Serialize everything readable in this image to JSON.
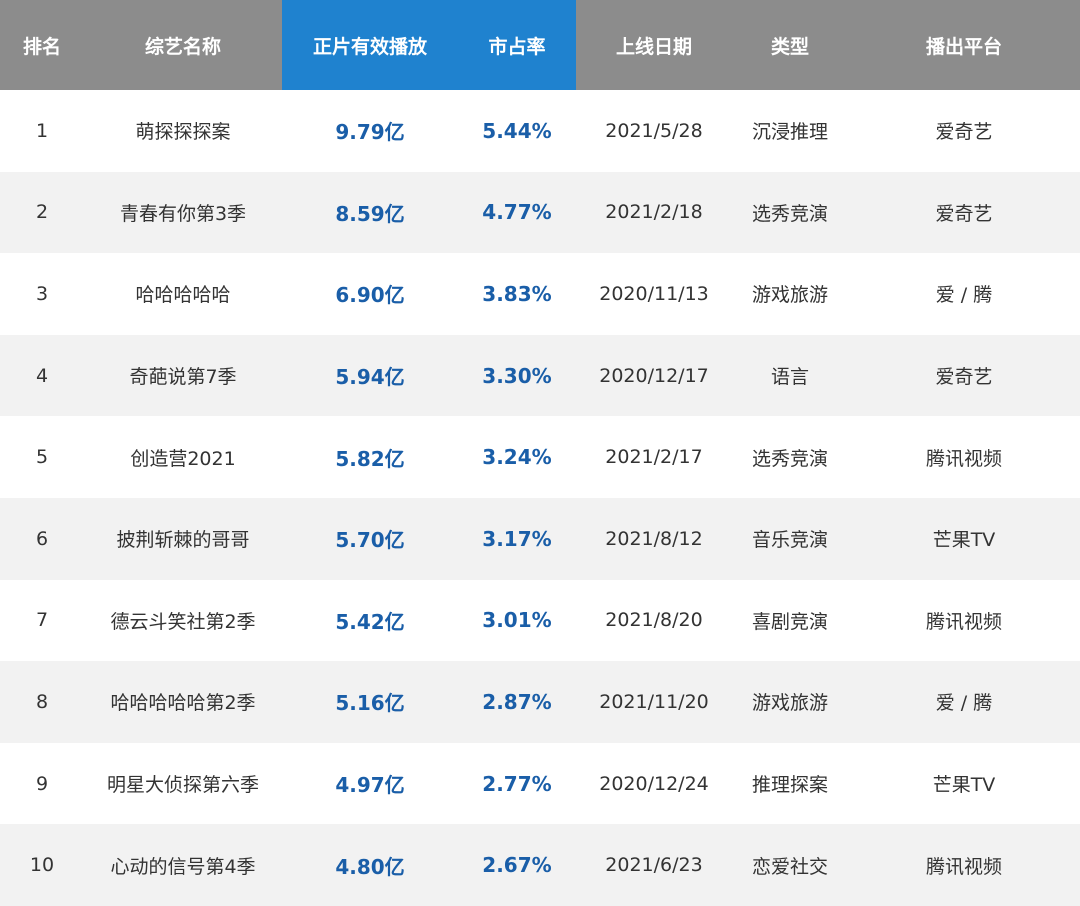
{
  "header": [
    "排名",
    "综艺名称",
    "正片有效播放",
    "市占率",
    "上线日期",
    "类型",
    "播出平台"
  ],
  "highlight_color": "#1f82cf",
  "header_color": "#8c8c8c",
  "value_color": "#1a5ea8",
  "rows": [
    [
      "1",
      "萌探探探案",
      "9.79亿",
      "5.44%",
      "2021/5/28",
      "沉浸推理",
      "爱奇艺"
    ],
    [
      "2",
      "青春有你第3季",
      "8.59亿",
      "4.77%",
      "2021/2/18",
      "选秀竞演",
      "爱奇艺"
    ],
    [
      "3",
      "哈哈哈哈哈",
      "6.90亿",
      "3.83%",
      "2020/11/13",
      "游戏旅游",
      "爱 / 腾"
    ],
    [
      "4",
      "奇葩说第7季",
      "5.94亿",
      "3.30%",
      "2020/12/17",
      "语言",
      "爱奇艺"
    ],
    [
      "5",
      "创造营2021",
      "5.82亿",
      "3.24%",
      "2021/2/17",
      "选秀竞演",
      "腾讯视频"
    ],
    [
      "6",
      "披荆斩棘的哥哥",
      "5.70亿",
      "3.17%",
      "2021/8/12",
      "音乐竞演",
      "芒果TV"
    ],
    [
      "7",
      "德云斗笑社第2季",
      "5.42亿",
      "3.01%",
      "2021/8/20",
      "喜剧竞演",
      "腾讯视频"
    ],
    [
      "8",
      "哈哈哈哈哈第2季",
      "5.16亿",
      "2.87%",
      "2021/11/20",
      "游戏旅游",
      "爱 / 腾"
    ],
    [
      "9",
      "明星大侦探第六季",
      "4.97亿",
      "2.77%",
      "2020/12/24",
      "推理探案",
      "芒果TV"
    ],
    [
      "10",
      "心动的信号第4季",
      "4.80亿",
      "2.67%",
      "2021/6/23",
      "恋爱社交",
      "腾讯视频"
    ]
  ]
}
